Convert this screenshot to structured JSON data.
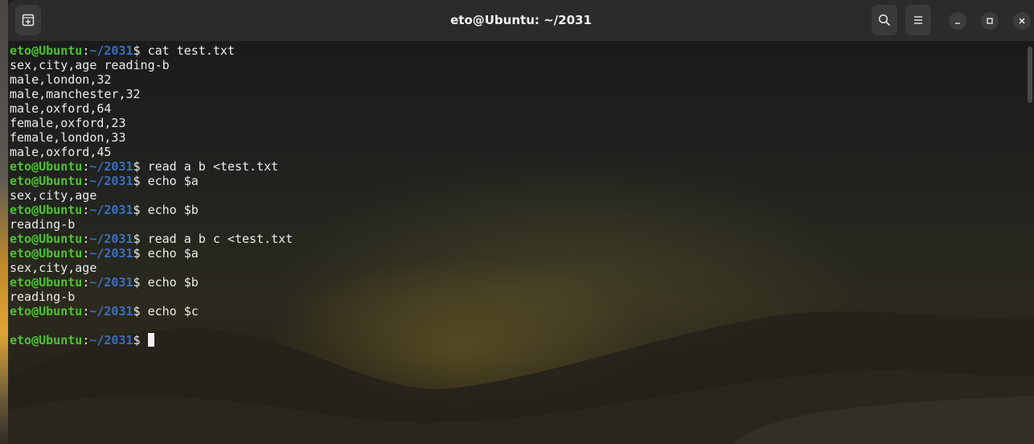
{
  "window": {
    "title": "eto@Ubuntu: ~/2031"
  },
  "titlebar": {
    "icons": {
      "new_tab": "new-tab-icon",
      "search": "search-icon",
      "menu": "hamburger-menu-icon",
      "minimize": "minimize-icon",
      "maximize": "maximize-icon",
      "close": "close-icon"
    }
  },
  "prompt": {
    "user": "eto@Ubuntu",
    "colon": ":",
    "path": "~/2031",
    "dollar": "$"
  },
  "colors": {
    "user": "#4fc134",
    "path": "#3a6fc0",
    "text": "#ececec"
  },
  "terminal": {
    "lines": [
      {
        "type": "cmd",
        "text": " cat test.txt"
      },
      {
        "type": "out",
        "text": "sex,city,age reading-b"
      },
      {
        "type": "out",
        "text": "male,london,32"
      },
      {
        "type": "out",
        "text": "male,manchester,32"
      },
      {
        "type": "out",
        "text": "male,oxford,64"
      },
      {
        "type": "out",
        "text": "female,oxford,23"
      },
      {
        "type": "out",
        "text": "female,london,33"
      },
      {
        "type": "out",
        "text": "male,oxford,45"
      },
      {
        "type": "cmd",
        "text": " read a b <test.txt"
      },
      {
        "type": "cmd",
        "text": " echo $a"
      },
      {
        "type": "out",
        "text": "sex,city,age"
      },
      {
        "type": "cmd",
        "text": " echo $b"
      },
      {
        "type": "out",
        "text": "reading-b"
      },
      {
        "type": "cmd",
        "text": " read a b c <test.txt"
      },
      {
        "type": "cmd",
        "text": " echo $a"
      },
      {
        "type": "out",
        "text": "sex,city,age"
      },
      {
        "type": "cmd",
        "text": " echo $b"
      },
      {
        "type": "out",
        "text": "reading-b"
      },
      {
        "type": "cmd",
        "text": " echo $c"
      },
      {
        "type": "out",
        "text": ""
      },
      {
        "type": "prompt",
        "text": " "
      }
    ]
  }
}
